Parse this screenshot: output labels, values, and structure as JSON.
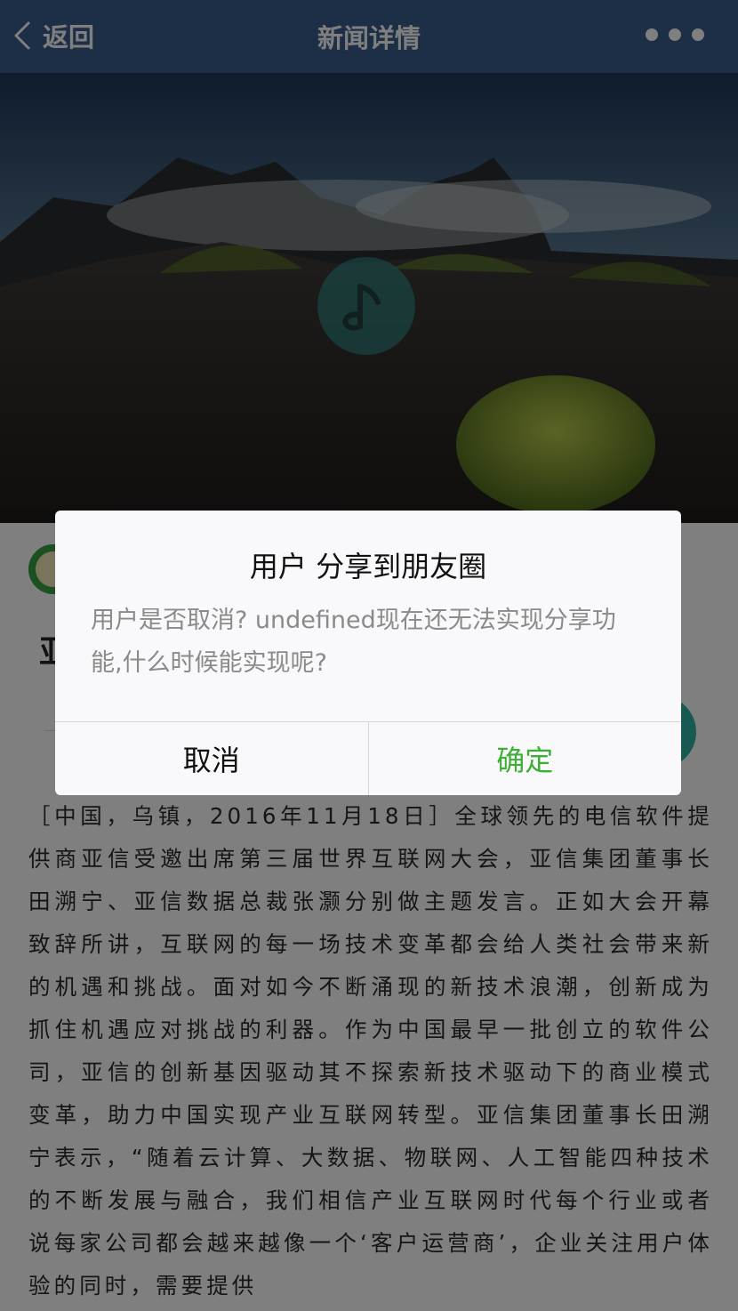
{
  "navbar": {
    "back_label": "返回",
    "title": "新闻详情",
    "more_icon": "ellipsis-icon",
    "background": "#3a5f8c"
  },
  "article": {
    "headline_fragment": "亚",
    "body": "［中国，乌镇，2016年11月18日］全球领先的电信软件提供商亚信受邀出席第三届世界互联网大会，亚信集团董事长田溯宁、亚信数据总裁张灏分别做主题发言。正如大会开幕致辞所讲，互联网的每一场技术变革都会给人类社会带来新的机遇和挑战。面对如今不断涌现的新技术浪潮，创新成为抓住机遇应对挑战的利器。作为中国最早一批创立的软件公司，亚信的创新基因驱动其不探索新技术驱动下的商业模式变革，助力中国实现产业互联网转型。亚信集团董事长田溯宁表示，“随着云计算、大数据、物联网、人工智能四种技术的不断发展与融合，我们相信产业互联网时代每个行业或者说每家公司都会越来越像一个‘客户运营商’，企业关注用户体验的同时，需要提供"
  },
  "dialog": {
    "title": "用户 分享到朋友圈",
    "message": "用户是否取消? undefined现在还无法实现分享功能,什么时候能实现呢?",
    "cancel_label": "取消",
    "confirm_label": "确定",
    "confirm_color": "#3cb034"
  }
}
